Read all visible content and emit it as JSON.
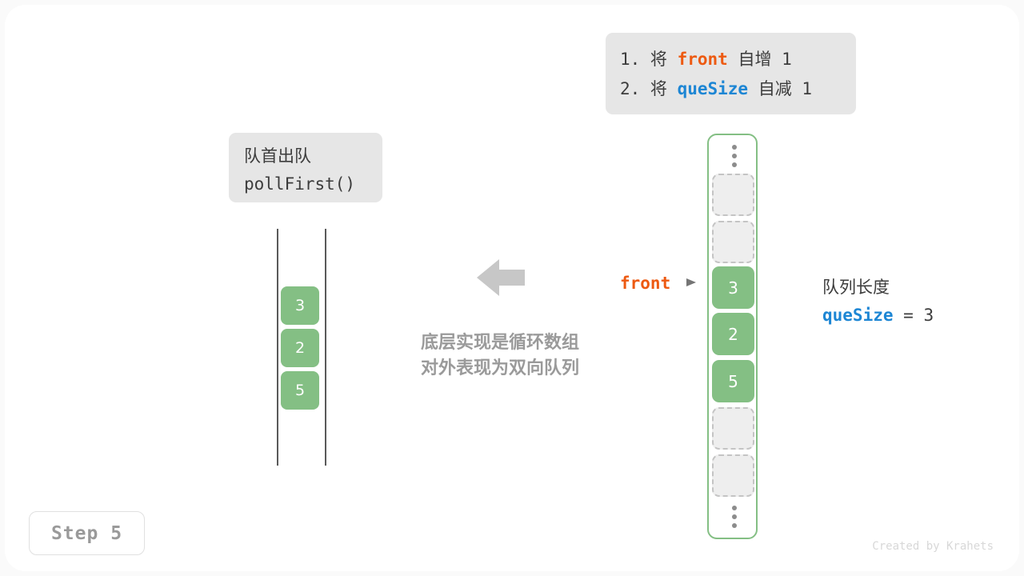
{
  "instruction_box": {
    "lines": [
      {
        "prefix": "1. 将 ",
        "keyword": "front",
        "keyword_color": "#ed5a12",
        "suffix": " 自增 1"
      },
      {
        "prefix": "2. 将 ",
        "keyword": "queSize",
        "keyword_color": "#1d86d4",
        "suffix": " 自减 1"
      }
    ]
  },
  "operation_label": {
    "title": "队首出队",
    "method": "pollFirst()"
  },
  "left_column": {
    "cells": [
      "3",
      "2",
      "5"
    ]
  },
  "center": {
    "arrow_direction": "left",
    "arrow_color": "#c7c7c7",
    "caption_line_1": "底层实现是循环数组",
    "caption_line_2": "对外表现为双向队列"
  },
  "front_pointer": {
    "label": "front",
    "color": "#ed5a12",
    "arrow_glyph": "triangle-right"
  },
  "circular_array": {
    "border_color": "#84bf84",
    "top_ellipsis": "vertical-dots",
    "bottom_ellipsis": "vertical-dots",
    "cells": [
      {
        "value": "",
        "state": "empty"
      },
      {
        "value": "",
        "state": "empty"
      },
      {
        "value": "3",
        "state": "filled"
      },
      {
        "value": "2",
        "state": "filled"
      },
      {
        "value": "5",
        "state": "filled"
      },
      {
        "value": "",
        "state": "empty"
      },
      {
        "value": "",
        "state": "empty"
      }
    ]
  },
  "side_note": {
    "title": "队列长度",
    "variable": "queSize",
    "variable_color": "#1d86d4",
    "equals": " = 3"
  },
  "step_badge": {
    "label": "Step 5"
  },
  "credit": {
    "text": "Created by Krahets"
  },
  "colors": {
    "filled_cell": "#84bf84",
    "empty_cell_bg": "#eeeeee",
    "empty_cell_border": "#c4c4c4",
    "box_bg": "#e6e6e6",
    "text": "#3c3c3c",
    "muted": "#9a9a9a"
  }
}
